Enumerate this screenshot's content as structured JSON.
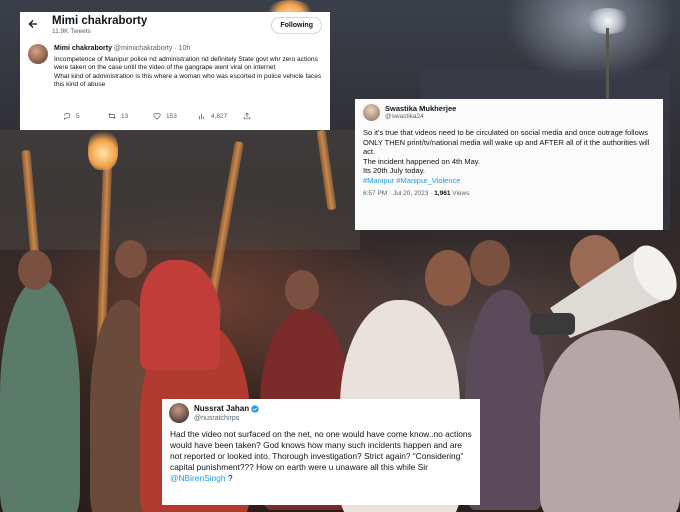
{
  "tweet_mimi": {
    "back_icon": "arrow-left-icon",
    "header_name": "Mimi chakraborty",
    "tweet_count": "11.9K Tweets",
    "follow_label": "Following",
    "author_name": "Mimi chakraborty",
    "author_handle": "@mimichakraborty",
    "separator": "·",
    "time": "10h",
    "text": "Incompetence of Manipur police nd administration nd definitely State govt whr zero actions were taken on the case until the video of the gangrape went viral on internet\nWhat kind of administration is this where a woman who was escorted in police vehicle faces this kind of abuse",
    "replies": "5",
    "retweets": "13",
    "likes": "153",
    "views": "4,827"
  },
  "tweet_swastika": {
    "author_name": "Swastika Mukherjee",
    "author_handle": "@swastika24",
    "line1": "So it's true that videos need to be circulated on social media and once outrage follows ONLY THEN print/tv/national media will wake up and AFTER all of it the authorities will act.",
    "line2": "The incident happened on 4th May.",
    "line3": "Its 20th July today.",
    "hashtags": "#Manipur #Manipur_Violence",
    "timestamp": "6:57 PM · Jul 20, 2023 · ",
    "views_count": "1,961",
    "views_label": " Views"
  },
  "tweet_nussrat": {
    "author_name": "Nussrat Jahan",
    "author_handle": "@nusratchirps",
    "text": "Had the video not surfaced on the net, no one would have come know..no actions would have been taken? God knows how many such incidents happen and are not reported or looked into. Thorough investigation? Strict again? “Considering” capital punishment??? How on earth were u unaware all this while Sir ",
    "mention": "@NBirenSingh",
    "text_end": " ?"
  },
  "colors": {
    "link": "#1d9bf0",
    "secondary_text": "#536471",
    "primary_text": "#0f1419"
  }
}
